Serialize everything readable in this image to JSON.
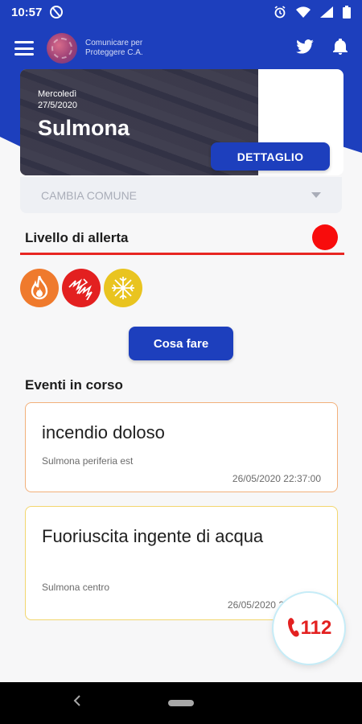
{
  "status_bar": {
    "time": "10:57"
  },
  "app_bar": {
    "logo_text": "Comunicare per Proteggere C.A."
  },
  "hero": {
    "day": "Mercoledì",
    "date": "27/5/2020",
    "city": "Sulmona",
    "detail_label": "DETTAGLIO"
  },
  "change_comune": {
    "label": "CAMBIA COMUNE"
  },
  "alert": {
    "title": "Livello di allerta",
    "level_color": "#f80c0c",
    "risks": [
      "fire-icon",
      "storm-icon",
      "snow-icon"
    ]
  },
  "actions": {
    "cosa_fare_label": "Cosa fare"
  },
  "events": {
    "title": "Eventi in corso",
    "items": [
      {
        "name": "incendio doloso",
        "location": "Sulmona periferia est",
        "time": "26/05/2020 22:37:00"
      },
      {
        "name": "Fuoriuscita ingente di acqua",
        "location": "Sulmona centro",
        "time": "26/05/2020 2"
      }
    ]
  },
  "emergency": {
    "number": "112"
  },
  "colors": {
    "primary": "#1d3fbd",
    "alert_red": "#e82622"
  }
}
